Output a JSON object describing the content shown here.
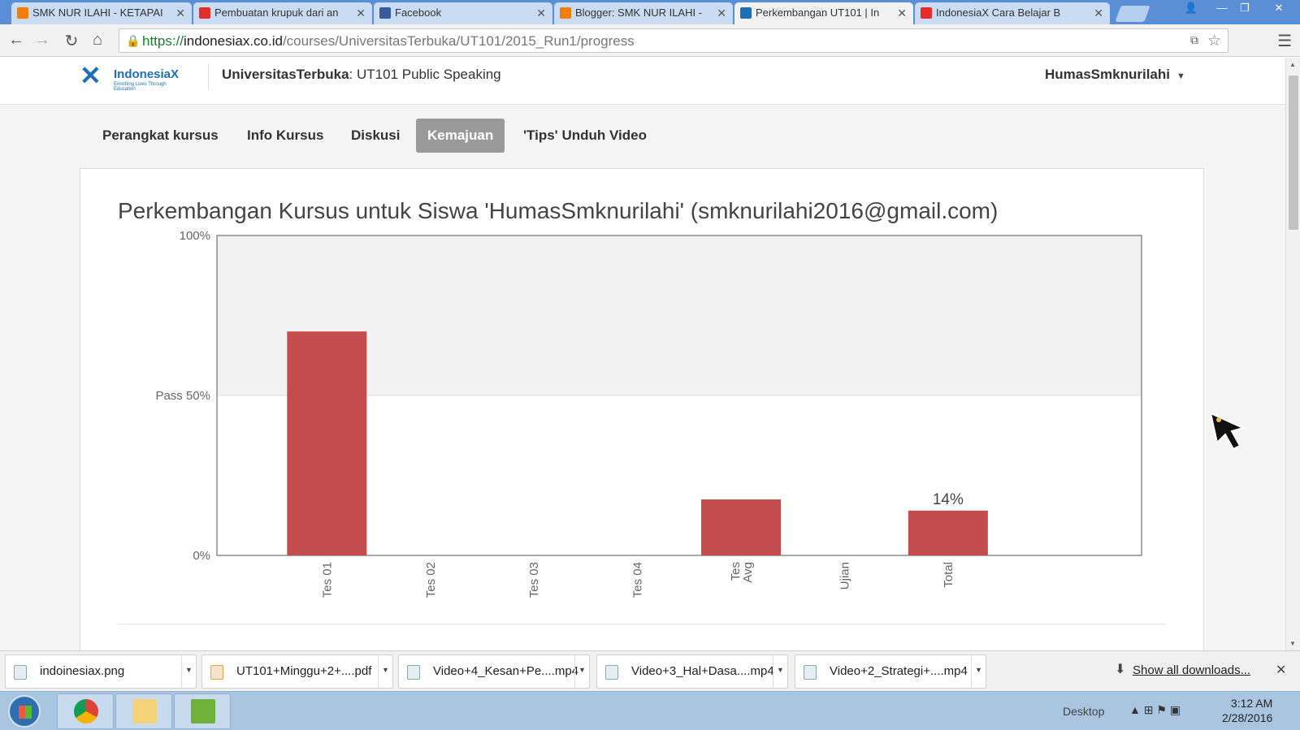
{
  "browser": {
    "tabs": [
      {
        "title": "SMK NUR ILAHI - KETAPAI",
        "favicon": "blogger-icon",
        "color": "#f57d00"
      },
      {
        "title": "Pembuatan krupuk dari an",
        "favicon": "youtube-icon",
        "color": "#e52d27"
      },
      {
        "title": "Facebook",
        "favicon": "facebook-icon",
        "color": "#3b5998"
      },
      {
        "title": "Blogger: SMK NUR ILAHI -",
        "favicon": "blogger-icon",
        "color": "#f57d00"
      },
      {
        "title": "Perkembangan UT101 | In",
        "favicon": "indonesiax-icon",
        "color": "#1f6fb3"
      },
      {
        "title": "IndonesiaX Cara Belajar B",
        "favicon": "youtube-icon",
        "color": "#e52d27"
      }
    ],
    "url_scheme": "https://",
    "url_host": "indonesiax.co.id",
    "url_path": "/courses/UniversitasTerbuka/UT101/2015_Run1/progress"
  },
  "site": {
    "logo_text": "IndonesiaX",
    "logo_tagline": "Enriching Lives Through Education",
    "course_org": "UniversitasTerbuka",
    "course_name": ": UT101 Public Speaking",
    "username": "HumasSmknurilahi"
  },
  "course_tabs": [
    {
      "label": "Perangkat kursus",
      "active": false
    },
    {
      "label": "Info Kursus",
      "active": false
    },
    {
      "label": "Diskusi",
      "active": false
    },
    {
      "label": "Kemajuan",
      "active": true
    },
    {
      "label": "'Tips' Unduh Video",
      "active": false
    }
  ],
  "progress": {
    "title": "Perkembangan Kursus untuk Siswa 'HumasSmknurilahi' (smknurilahi2016@gmail.com)"
  },
  "chart_data": {
    "type": "bar",
    "title": "Perkembangan Kursus untuk Siswa 'HumasSmknurilahi' (smknurilahi2016@gmail.com)",
    "categories": [
      "Tes 01",
      "Tes 02",
      "Tes 03",
      "Tes 04",
      "Tes Avg",
      "Ujian",
      "Total"
    ],
    "values": [
      70,
      0,
      0,
      0,
      17.5,
      0,
      14
    ],
    "ylim": [
      0,
      100
    ],
    "yticks": [
      {
        "value": 100,
        "label": "100%"
      },
      {
        "value": 50,
        "label": "Pass 50%"
      },
      {
        "value": 0,
        "label": "0%"
      }
    ],
    "value_labels": {
      "Total": "14%"
    },
    "pass_line": 50,
    "bar_color": "#c44c4c",
    "above_pass_band": "#f2f2f2"
  },
  "downloads": {
    "items": [
      {
        "name": "indoinesiax.png"
      },
      {
        "name": "UT101+Minggu+2+....pdf"
      },
      {
        "name": "Video+4_Kesan+Pe....mp4"
      },
      {
        "name": "Video+3_Hal+Dasa....mp4"
      },
      {
        "name": "Video+2_Strategi+....mp4"
      }
    ],
    "show_all": "Show all downloads..."
  },
  "taskbar": {
    "desktop_label": "Desktop",
    "time": "3:12 AM",
    "date": "2/28/2016"
  }
}
